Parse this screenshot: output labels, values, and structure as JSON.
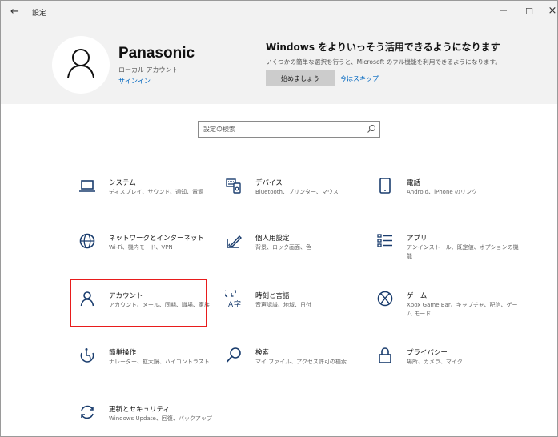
{
  "window": {
    "title": "設定",
    "back": "←",
    "minimize": "−",
    "maximize": "☐",
    "close": "×"
  },
  "header": {
    "user_name": "Panasonic",
    "account_type": "ローカル アカウント",
    "signin": "サインイン",
    "promo_title": "Windows をよりいっそう活用できるようになります",
    "promo_desc": "いくつかの簡単な選択を行うと、Microsoft のフル機能を利用できるようになります。",
    "start_button": "始めましょう",
    "skip": "今はスキップ"
  },
  "search": {
    "placeholder": "設定の検索"
  },
  "categories": [
    {
      "name": "system",
      "icon": "laptop-icon",
      "title": "システム",
      "desc": "ディスプレイ、サウンド、通知、電源"
    },
    {
      "name": "devices",
      "icon": "keyboard-icon",
      "title": "デバイス",
      "desc": "Bluetooth、プリンター、マウス"
    },
    {
      "name": "phone",
      "icon": "phone-icon",
      "title": "電話",
      "desc": "Android、iPhone のリンク"
    },
    {
      "name": "network",
      "icon": "globe-icon",
      "title": "ネットワークとインターネット",
      "desc": "Wi-Fi、機内モード、VPN"
    },
    {
      "name": "personalization",
      "icon": "personalization-icon",
      "title": "個人用設定",
      "desc": "背景、ロック画面、色"
    },
    {
      "name": "apps",
      "icon": "apps-icon",
      "title": "アプリ",
      "desc": "アンインストール、既定値、オプションの機能"
    },
    {
      "name": "accounts",
      "icon": "person-icon",
      "title": "アカウント",
      "desc": "アカウント、メール、同期、職場、家族"
    },
    {
      "name": "time-language",
      "icon": "time-language-icon",
      "title": "時刻と言語",
      "desc": "音声認識、地域、日付"
    },
    {
      "name": "gaming",
      "icon": "xbox-icon",
      "title": "ゲーム",
      "desc": "Xbox Game Bar、キャプチャ、配信、ゲーム モード"
    },
    {
      "name": "ease-of-access",
      "icon": "ease-of-access-icon",
      "title": "簡単操作",
      "desc": "ナレーター、拡大鏡、ハイコントラスト"
    },
    {
      "name": "search",
      "icon": "search-icon",
      "title": "検索",
      "desc": "マイ ファイル、アクセス許可の検索"
    },
    {
      "name": "privacy",
      "icon": "lock-icon",
      "title": "プライバシー",
      "desc": "場所、カメラ、マイク"
    },
    {
      "name": "update-security",
      "icon": "sync-icon",
      "title": "更新とセキュリティ",
      "desc": "Windows Update、回復、バックアップ"
    }
  ],
  "colors": {
    "accent": "#0067c0",
    "header_bg": "#f2f2f2",
    "highlight": "#e81c1c",
    "icon": "#1a3d6e"
  }
}
